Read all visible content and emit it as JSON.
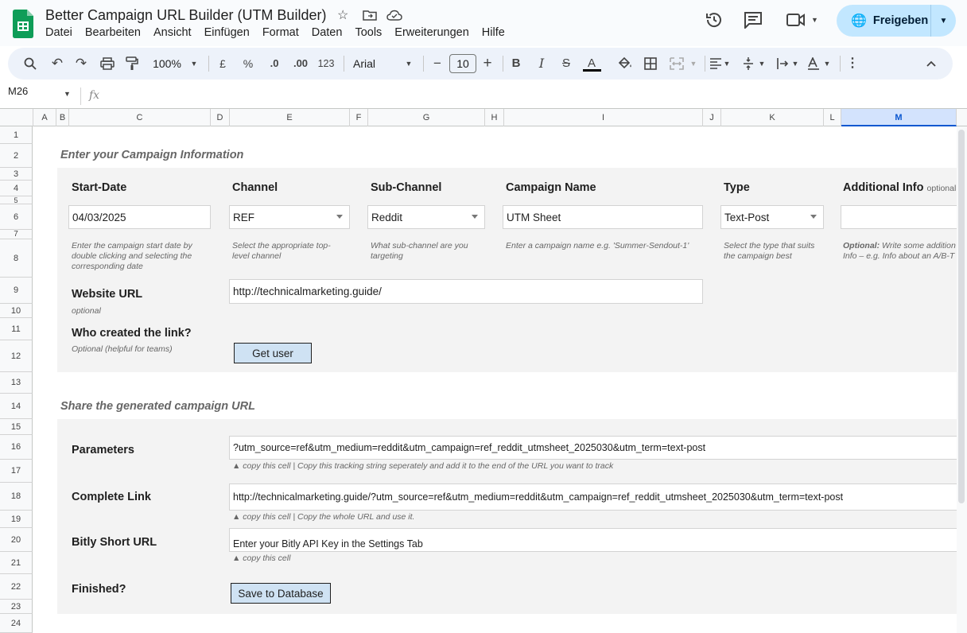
{
  "app": {
    "title": "Better Campaign URL Builder (UTM Builder)",
    "menu": [
      "Datei",
      "Bearbeiten",
      "Ansicht",
      "Einfügen",
      "Format",
      "Daten",
      "Tools",
      "Erweiterungen",
      "Hilfe"
    ],
    "share_label": "Freigeben"
  },
  "toolbar": {
    "zoom": "100%",
    "currency": "£",
    "percent": "%",
    "dec_decrease": ".0",
    "dec_increase": ".00",
    "number_format": "123",
    "font": "Arial",
    "font_size": "10",
    "minus": "−",
    "plus": "+"
  },
  "formula_bar": {
    "cell_ref": "M26",
    "fx": "fx"
  },
  "columns": [
    "A",
    "B",
    "C",
    "D",
    "E",
    "F",
    "G",
    "H",
    "I",
    "J",
    "K",
    "L",
    "M"
  ],
  "selected_column": "M",
  "rows": [
    "1",
    "2",
    "3",
    "4",
    "5",
    "6",
    "7",
    "8",
    "9",
    "10",
    "11",
    "12",
    "13",
    "14",
    "15",
    "16",
    "17",
    "18",
    "19",
    "20",
    "21",
    "22",
    "23",
    "24"
  ],
  "campaign": {
    "section_title": "Enter your Campaign Information",
    "start_date": {
      "label": "Start-Date",
      "value": "04/03/2025",
      "hint": "Enter the campaign start date by double clicking and selecting the corresponding date"
    },
    "channel": {
      "label": "Channel",
      "value": "REF",
      "hint": "Select the appropriate top-level channel"
    },
    "sub_channel": {
      "label": "Sub-Channel",
      "value": "Reddit",
      "hint": "What sub-channel are you targeting"
    },
    "campaign_name": {
      "label": "Campaign Name",
      "value": "UTM Sheet",
      "hint": "Enter a campaign name e.g. 'Summer-Sendout-1'"
    },
    "type": {
      "label": "Type",
      "value": "Text-Post",
      "hint": "Select the type that suits the campaign best"
    },
    "additional_info": {
      "label": "Additional Info",
      "optional": "optional",
      "value": "",
      "hint_bold": "Optional:",
      "hint": " Write some addition Info – e.g. Info about an A/B-T"
    },
    "website_url": {
      "label": "Website URL",
      "sub": "optional",
      "value": "http://technicalmarketing.guide/"
    },
    "creator": {
      "label": "Who created the link?",
      "sub": "Optional (helpful for teams)",
      "button": "Get user"
    }
  },
  "share": {
    "section_title": "Share the generated campaign URL",
    "parameters": {
      "label": "Parameters",
      "value": "?utm_source=ref&utm_medium=reddit&utm_campaign=ref_reddit_utmsheet_2025030&utm_term=text-post",
      "hint": "▲ copy this cell | Copy this tracking string seperately and add it to the end of the URL you want to track"
    },
    "complete_link": {
      "label": "Complete Link",
      "value": "http://technicalmarketing.guide/?utm_source=ref&utm_medium=reddit&utm_campaign=ref_reddit_utmsheet_2025030&utm_term=text-post",
      "hint": "▲ copy this cell | Copy the whole URL and use it."
    },
    "bitly": {
      "label": "Bitly Short URL",
      "value": "Enter your Bitly API Key in the Settings Tab",
      "hint": "▲ copy this cell"
    },
    "finished": {
      "label": "Finished?",
      "button": "Save to Database"
    }
  }
}
